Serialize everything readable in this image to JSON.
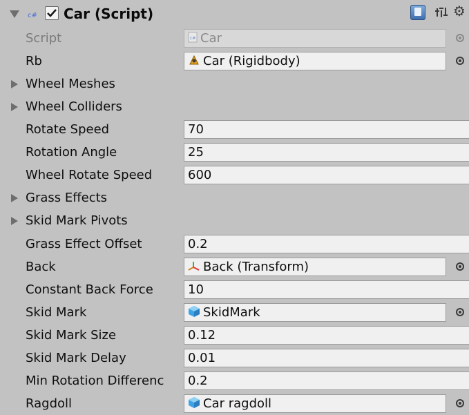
{
  "component": {
    "title": "Car (Script)",
    "cs_icon_label": "c#",
    "enabled": true
  },
  "rows": {
    "script": {
      "label": "Script",
      "value": "Car"
    },
    "rb": {
      "label": "Rb",
      "value": "Car (Rigidbody)"
    },
    "wheel_meshes": {
      "label": "Wheel Meshes"
    },
    "wheel_colliders": {
      "label": "Wheel Colliders"
    },
    "rotate_speed": {
      "label": "Rotate Speed",
      "value": "70"
    },
    "rotation_angle": {
      "label": "Rotation Angle",
      "value": "25"
    },
    "wheel_rotate_speed": {
      "label": "Wheel Rotate Speed",
      "value": "600"
    },
    "grass_effects": {
      "label": "Grass Effects"
    },
    "skid_mark_pivots": {
      "label": "Skid Mark Pivots"
    },
    "grass_effect_offset": {
      "label": "Grass Effect Offset",
      "value": "0.2"
    },
    "back": {
      "label": "Back",
      "value": "Back (Transform)"
    },
    "constant_back_force": {
      "label": "Constant Back Force",
      "value": "10"
    },
    "skid_mark": {
      "label": "Skid Mark",
      "value": "SkidMark"
    },
    "skid_mark_size": {
      "label": "Skid Mark Size",
      "value": "0.12"
    },
    "skid_mark_delay": {
      "label": "Skid Mark Delay",
      "value": "0.01"
    },
    "min_rotation_difference": {
      "label": "Min Rotation Differenc",
      "value": "0.2"
    },
    "ragdoll": {
      "label": "Ragdoll",
      "value": "Car ragdoll"
    }
  },
  "icons": {
    "component": "csharp-script-icon",
    "help": "help-book-icon",
    "preset": "preset-icon",
    "settings": "gear-icon",
    "rigidbody": "rigidbody-icon",
    "transform": "transform-icon",
    "prefab": "prefab-cube-icon",
    "script_file": "script-file-icon",
    "picker": "object-picker-icon"
  },
  "colors": {
    "background": "#c2c2c2",
    "field": "#f0f0f0",
    "prefab_blue": "#3ea3e6"
  }
}
